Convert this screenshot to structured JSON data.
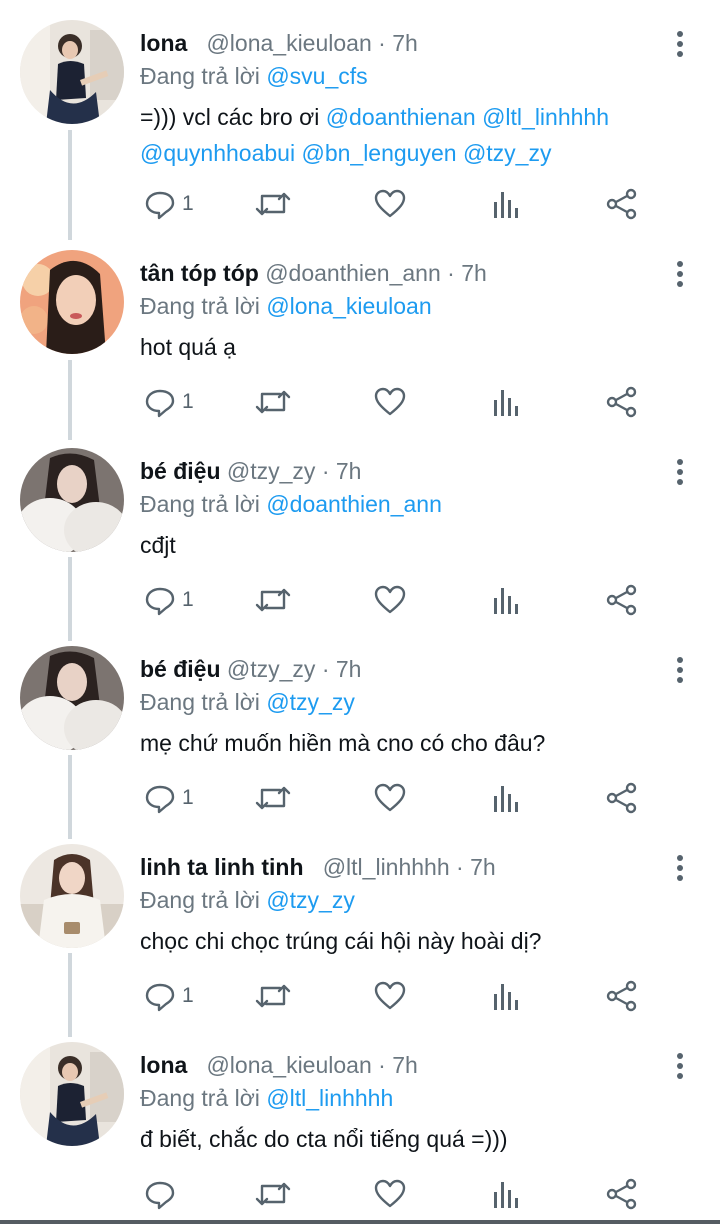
{
  "colors": {
    "accent": "#1d9bf0",
    "muted": "#6b7780",
    "thread_line": "#d0d7dc"
  },
  "icons": [
    "reply-icon",
    "retweet-icon",
    "like-icon",
    "views-icon",
    "share-icon",
    "more-icon"
  ],
  "tweets": [
    {
      "name": "lona",
      "handle": "@lona_kieuloan",
      "time": "7h",
      "reply_prefix": "Đang trả lời",
      "reply_to": "@svu_cfs",
      "text_lead": "=))) vcl các bro ơi",
      "mentions_line1": "@doanthienan @ltl_linhhhh",
      "mentions_line2": "@quynhhoabui @bn_lenguyen @tzy_zy",
      "reply_count": "1"
    },
    {
      "name": "tân tóp tóp",
      "handle": "@doanthien_ann",
      "time": "7h",
      "reply_prefix": "Đang trả lời",
      "reply_to": "@lona_kieuloan",
      "text": "hot quá ạ",
      "reply_count": "1"
    },
    {
      "name": "bé điệu",
      "handle": "@tzy_zy",
      "time": "7h",
      "reply_prefix": "Đang trả lời",
      "reply_to": "@doanthien_ann",
      "text": "cđjt",
      "reply_count": "1"
    },
    {
      "name": "bé điệu",
      "handle": "@tzy_zy",
      "time": "7h",
      "reply_prefix": "Đang trả lời",
      "reply_to": "@tzy_zy",
      "text": "mẹ chứ muốn hiền mà cno có cho đâu?",
      "reply_count": "1"
    },
    {
      "name": "linh ta linh tinh",
      "handle": "@ltl_linhhhh",
      "time": "7h",
      "reply_prefix": "Đang trả lời",
      "reply_to": "@tzy_zy",
      "text": "chọc chi chọc trúng cái hội này hoài dị?",
      "reply_count": "1"
    },
    {
      "name": "lona",
      "handle": "@lona_kieuloan",
      "time": "7h",
      "reply_prefix": "Đang trả lời",
      "reply_to": "@ltl_linhhhh",
      "text": "đ biết, chắc do cta nổi tiếng quá =)))",
      "reply_count": ""
    }
  ]
}
